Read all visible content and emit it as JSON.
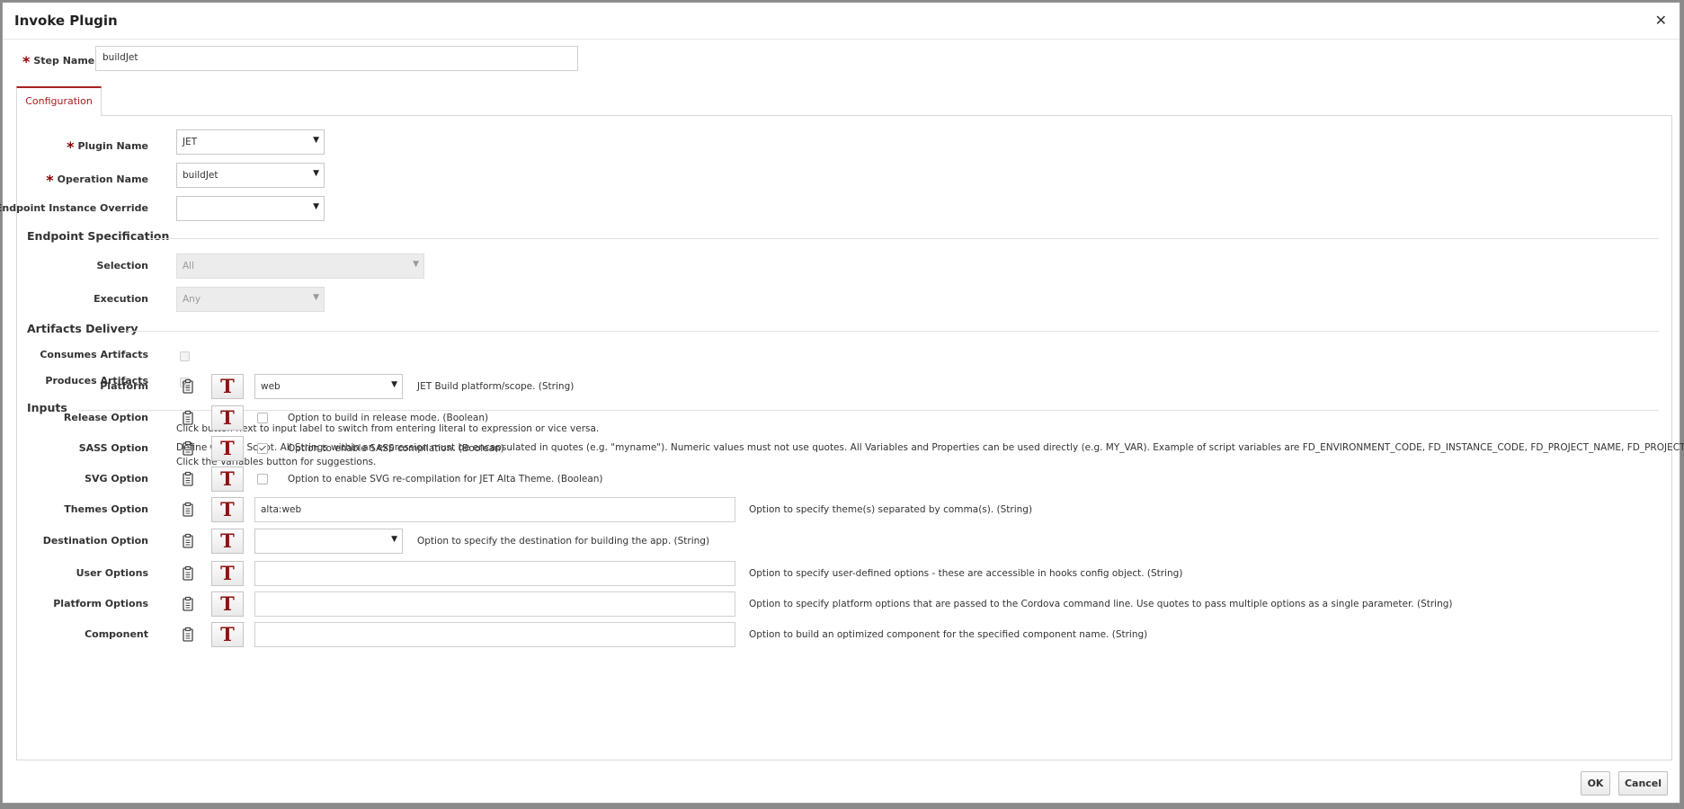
{
  "dialog": {
    "title": "Invoke Plugin",
    "close_glyph": "✕"
  },
  "step_name": {
    "label": "Step Name",
    "value": "buildJet",
    "required_mark": "*"
  },
  "tabs": [
    {
      "label": "Configuration",
      "active": true
    }
  ],
  "config": {
    "plugin_name": {
      "label": "Plugin Name",
      "value": "JET",
      "required_mark": "*"
    },
    "operation_name": {
      "label": "Operation Name",
      "value": "buildJet",
      "required_mark": "*"
    },
    "endpoint_override": {
      "label": "Endpoint Instance Override",
      "value": ""
    }
  },
  "endpoint_spec": {
    "heading": "Endpoint Specification",
    "selection": {
      "label": "Selection",
      "value": "All"
    },
    "execution": {
      "label": "Execution",
      "value": "Any"
    }
  },
  "artifacts": {
    "heading": "Artifacts Delivery",
    "consumes": {
      "label": "Consumes Artifacts",
      "checked": false
    },
    "produces": {
      "label": "Produces Artifacts",
      "checked": true
    }
  },
  "inputs": {
    "heading": "Inputs",
    "info_1": "Click button next to input label to switch from entering literal to expression or vice versa.",
    "info_2": "Define Groovy Script. All Strings within an expression must be encapsulated in quotes (e.g. \"myname\"). Numeric values must not use quotes. All Variables and Properties can be used directly (e.g. MY_VAR). Example of script variables are FD_ENVIRONMENT_CODE, FD_INSTANCE_CODE, FD_PROJECT_NAME, FD_PROJECT_VERSION.",
    "info_3": "Click the Variables button for suggestions.",
    "toggle_glyph": "T",
    "rows": [
      {
        "label": "Platform",
        "type": "select",
        "value": "web",
        "desc": "JET Build platform/scope. (String)"
      },
      {
        "label": "Release Option",
        "type": "checkbox",
        "checked": false,
        "desc": "Option to build in release mode. (Boolean)"
      },
      {
        "label": "SASS Option",
        "type": "checkbox",
        "checked": true,
        "desc": "Option to enable SASS compilation. (Boolean)"
      },
      {
        "label": "SVG Option",
        "type": "checkbox",
        "checked": false,
        "desc": "Option to enable SVG re-compilation for JET Alta Theme. (Boolean)"
      },
      {
        "label": "Themes Option",
        "type": "text",
        "value": "alta:web",
        "desc": "Option to specify theme(s) separated by comma(s). (String)"
      },
      {
        "label": "Destination Option",
        "type": "select",
        "value": "",
        "desc": "Option to specify the destination for building the app. (String)"
      },
      {
        "label": "User Options",
        "type": "text",
        "value": "",
        "desc": "Option to specify user-defined options - these are accessible in hooks config object. (String)"
      },
      {
        "label": "Platform Options",
        "type": "text",
        "value": "",
        "desc": "Option to specify platform options that are passed to the Cordova command line. Use quotes to pass multiple options as a single parameter. (String)"
      },
      {
        "label": "Component",
        "type": "text",
        "value": "",
        "desc": "Option to build an optimized component for the specified component name. (String)"
      }
    ]
  },
  "footer": {
    "ok_label": "OK",
    "cancel_label": "Cancel"
  },
  "colors": {
    "accent": "#a62121",
    "toggle_icon": "#8b1414",
    "required": "#8b0000"
  },
  "icons": {
    "clipboard": "clipboard-icon",
    "dropdown": "dropdown-arrow-icon",
    "close": "close-icon"
  }
}
